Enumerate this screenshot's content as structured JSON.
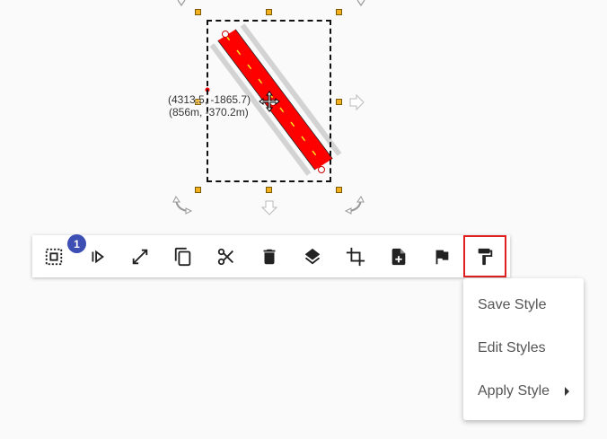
{
  "canvas": {
    "coordinate_readout": {
      "line1": "(4313.5, -1865.7)",
      "line2": "(856m, -370.2m)"
    }
  },
  "toolbar": {
    "selection_count_badge": "1",
    "tools": [
      {
        "name": "select-icon",
        "label": "Select"
      },
      {
        "name": "play-step-icon",
        "label": "Step"
      },
      {
        "name": "resize-icon",
        "label": "Resize"
      },
      {
        "name": "copy-icon",
        "label": "Copy"
      },
      {
        "name": "cut-icon",
        "label": "Cut"
      },
      {
        "name": "delete-icon",
        "label": "Delete"
      },
      {
        "name": "layers-icon",
        "label": "Layers"
      },
      {
        "name": "crop-icon",
        "label": "Crop"
      },
      {
        "name": "add-file-icon",
        "label": "Add"
      },
      {
        "name": "flag-icon",
        "label": "Flag"
      },
      {
        "name": "format-paint-icon",
        "label": "Style"
      }
    ],
    "active_tool": "format-paint-icon"
  },
  "style_menu": {
    "items": [
      {
        "label": "Save Style"
      },
      {
        "label": "Edit Styles"
      },
      {
        "label": "Apply Style",
        "has_submenu": true
      }
    ]
  },
  "colors": {
    "road": "#ff0000",
    "lane_marking": "#f3e020",
    "handle": "#f2b01e",
    "badge": "#3d4fb5",
    "active_border": "#e02020"
  }
}
